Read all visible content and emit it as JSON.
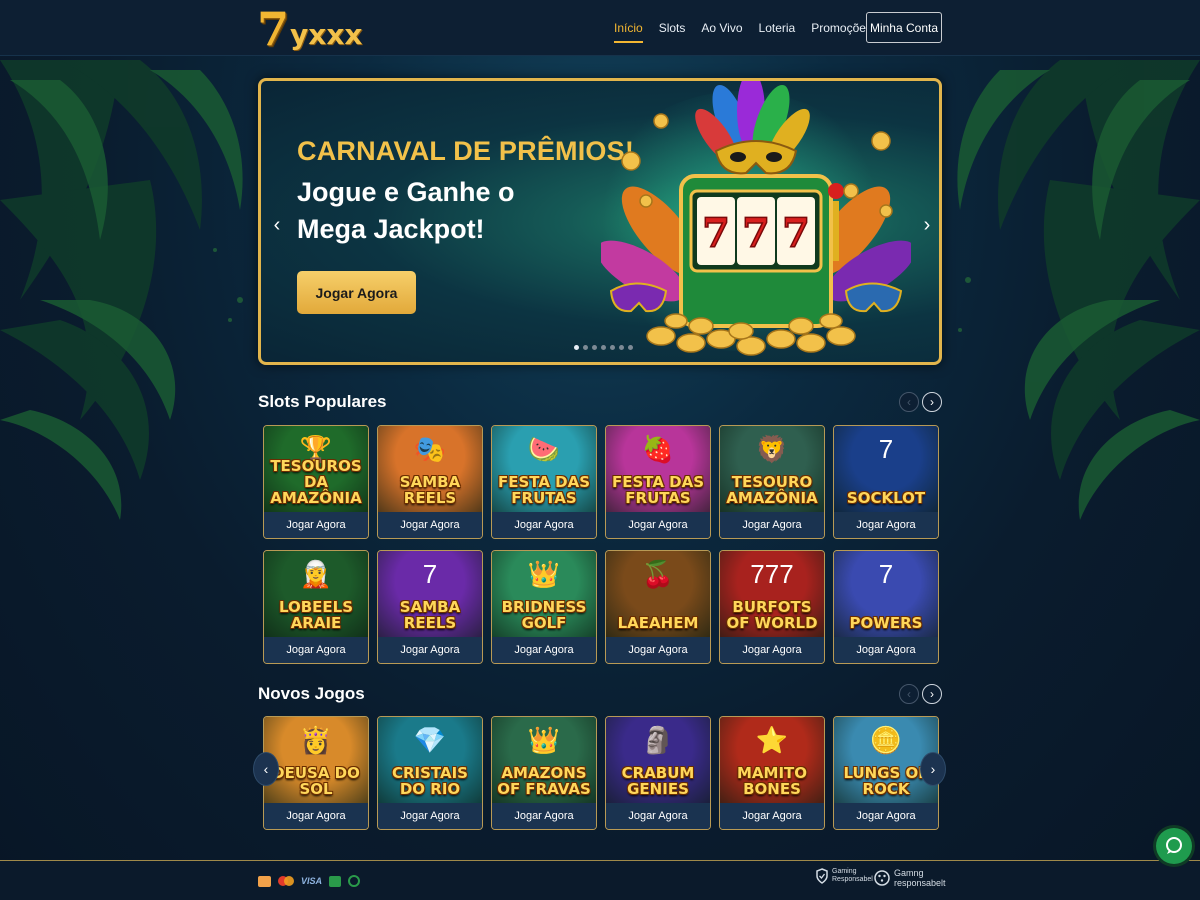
{
  "brand": {
    "logo_seven": "7",
    "logo_rest": "yxxx"
  },
  "nav": {
    "items": [
      "Início",
      "Slots",
      "Ao Vivo",
      "Loteria",
      "Promoções"
    ],
    "account_label": "Minha Conta"
  },
  "banner": {
    "title": "CARNAVAL DE PRÊMIOS!",
    "subtitle": "Jogue e Ganhe o Mega Jackpot!",
    "cta_label": "Jogar Agora",
    "prev_arrow": "‹",
    "next_arrow": "›",
    "reels": [
      "7",
      "7",
      "7"
    ]
  },
  "popular": {
    "title": "Slots Populares",
    "games": [
      {
        "name": "TESOUROS DA AMAZÔNIA",
        "play": "Jogar Agora",
        "bg": "#1f6b2a",
        "emblem": "🏆"
      },
      {
        "name": "SAMBA REELS",
        "play": "Jogar Agora",
        "bg": "#d8732a",
        "emblem": "🎭"
      },
      {
        "name": "FESTA DAS FRUTAS",
        "play": "Jogar Agora",
        "bg": "#2a9fb0",
        "emblem": "🍉"
      },
      {
        "name": "FESTA DAS FRUTAS",
        "play": "Jogar Agora",
        "bg": "#b8359a",
        "emblem": "🍓"
      },
      {
        "name": "TESOURO AMAZÔNIA",
        "play": "Jogar Agora",
        "bg": "#2f5f4f",
        "emblem": "🦁"
      },
      {
        "name": "SOCKLOT",
        "play": "Jogar Agora",
        "bg": "#1a3f8a",
        "emblem": "7"
      },
      {
        "name": "LOBEELS ARAIE",
        "play": "Jogar Agora",
        "bg": "#1d5a2a",
        "emblem": "🧝"
      },
      {
        "name": "SAMBA REELS",
        "play": "Jogar Agora",
        "bg": "#6a2aa8",
        "emblem": "7"
      },
      {
        "name": "BRIDNESS GOLF",
        "play": "Jogar Agora",
        "bg": "#2a8a5a",
        "emblem": "👑"
      },
      {
        "name": "LAEAHEM",
        "play": "Jogar Agora",
        "bg": "#7a4a1a",
        "emblem": "🍒"
      },
      {
        "name": "BURFOTS OF WORLD",
        "play": "Jogar Agora",
        "bg": "#a8221e",
        "emblem": "777"
      },
      {
        "name": "POWERS",
        "play": "Jogar Agora",
        "bg": "#3a4ab0",
        "emblem": "7"
      }
    ]
  },
  "new_games": {
    "title": "Novos Jogos",
    "games": [
      {
        "name": "DEUSA DO SOL",
        "play": "Jogar Agora",
        "bg": "#d88a2a",
        "emblem": "👸"
      },
      {
        "name": "CRISTAIS DO RIO",
        "play": "Jogar Agora",
        "bg": "#1a7a8a",
        "emblem": "💎"
      },
      {
        "name": "AMAZONS OF FRAVAS",
        "play": "Jogar Agora",
        "bg": "#2a6a4a",
        "emblem": "👑"
      },
      {
        "name": "CRABUM GENIES",
        "play": "Jogar Agora",
        "bg": "#3a2a8a",
        "emblem": "🗿"
      },
      {
        "name": "MAMITO BONES",
        "play": "Jogar Agora",
        "bg": "#b02a1a",
        "emblem": "⭐"
      },
      {
        "name": "LUNGS OF ROCK",
        "play": "Jogar Agora",
        "bg": "#3a8ab0",
        "emblem": "🪙"
      }
    ]
  },
  "footer": {
    "payments": [
      "VISA"
    ],
    "badge1": "Gaming Responsabel",
    "badge2_line1": "Gamng",
    "badge2_line2": "responsabelt"
  },
  "colors": {
    "accent": "#f2b632",
    "background": "#0b1d30",
    "card_border": "#b89a55",
    "chat": "#1f9b4e"
  }
}
